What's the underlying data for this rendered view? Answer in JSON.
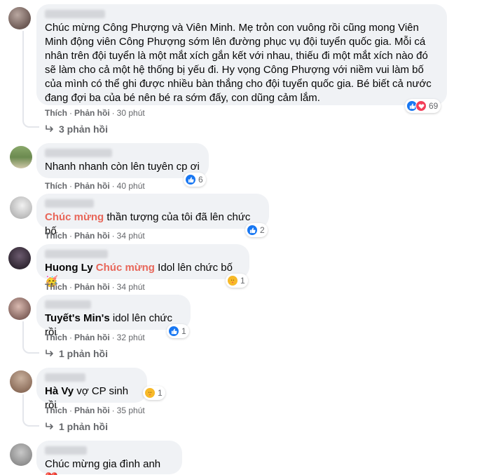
{
  "labels": {
    "like": "Thích",
    "reply": "Phản hồi",
    "dot": "·"
  },
  "comments": [
    {
      "text": "Chúc mừng Công Phượng và Viên Minh. Mẹ trỏn con vuông rồi cũng mong Viên Minh động viên Công Phượng sớm lên đường phục vụ đội tuyển quốc gia. Mỗi cá nhân trên đội tuyển là một mắt xích gắn kết với nhau, thiếu đi một mắt xích nào đó sẽ làm cho cả một hệ thống bị yếu đi. Hy vọng Công Phượng với niềm vui làm bố của mình có thể ghi được nhiều bàn thắng cho đội tuyển quốc gia. Bé biết cả nước đang đợi ba của bé nên bé ra sớm đấy, con dũng cảm lắm.",
      "time": "30 phút",
      "reactions": [
        "like",
        "love"
      ],
      "reaction_count": "69",
      "replies": "3 phản hồi"
    },
    {
      "text": "Nhanh nhanh còn lên tuyên cp ơi",
      "time": "40 phút",
      "reactions": [
        "like"
      ],
      "reaction_count": "6"
    },
    {
      "highlight": "Chúc mừng",
      "text": "thần tượng của tôi đã lên chức bố",
      "time": "34 phút",
      "reactions": [
        "like"
      ],
      "reaction_count": "2"
    },
    {
      "tag": "Huong Ly",
      "highlight": "Chúc mừng",
      "text": "Idol lên chức bố",
      "emoji": "🥳",
      "time": "34 phút",
      "reactions": [
        "care"
      ],
      "reaction_count": "1"
    },
    {
      "tag": "Tuyết's Min's",
      "text": "idol lên chức rồi",
      "time": "32 phút",
      "reactions": [
        "like"
      ],
      "reaction_count": "1",
      "replies": "1 phản hồi"
    },
    {
      "tag": "Hà Vy",
      "text": "vợ CP sinh rồi",
      "time": "35 phút",
      "reactions": [
        "care"
      ],
      "reaction_count": "1",
      "replies": "1 phản hồi"
    },
    {
      "text": "Chúc mừng gia đình anh",
      "emoji": "❤️"
    }
  ],
  "colors": {
    "bubble": "#f0f2f5",
    "meta": "#65676b",
    "highlight": "#e8675a",
    "like": "#1877f2",
    "love": "#f33e58",
    "care": "#f7b928"
  },
  "icons": [
    "like-icon",
    "love-icon",
    "care-icon",
    "reply-arrow-icon"
  ]
}
